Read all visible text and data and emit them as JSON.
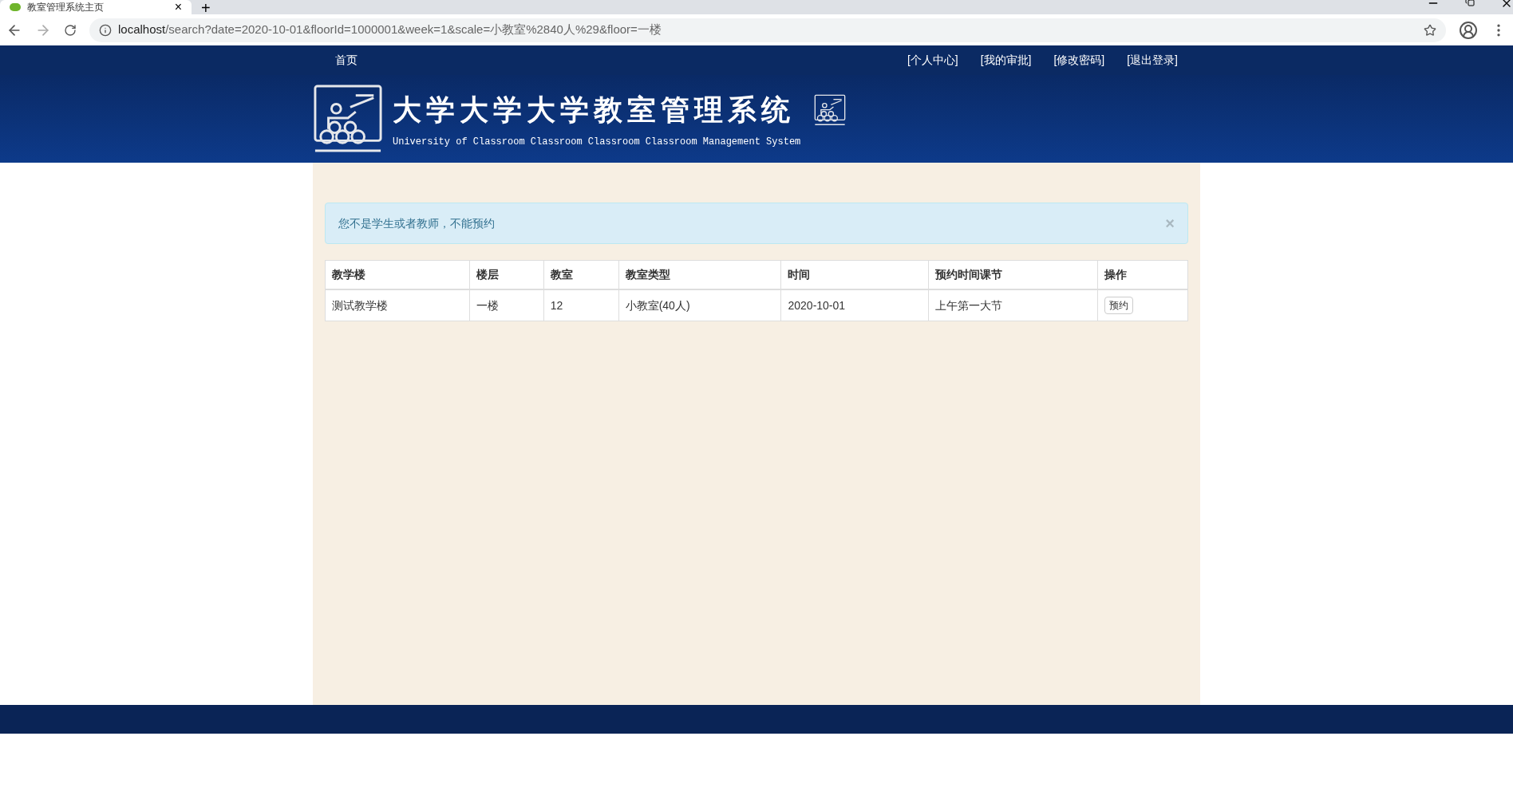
{
  "browser": {
    "tab_title": "教室管理系统主页",
    "new_tab": "+",
    "tab_close": "×",
    "url_host": "localhost",
    "url_path": "/search?date=2020-10-01&floorId=1000001&week=1&scale=小教室%2840人%29&floor=一楼"
  },
  "navbar": {
    "home": "首页",
    "links": [
      "[个人中心]",
      "[我的审批]",
      "[修改密码]",
      "[退出登录]"
    ]
  },
  "banner": {
    "title": "大学大学大学教室管理系统",
    "subtitle": "University of Classroom Classroom Classroom Classroom Management System"
  },
  "alert": {
    "text": "您不是学生或者教师，不能预约",
    "close": "×"
  },
  "table": {
    "columns": [
      "教学楼",
      "楼层",
      "教室",
      "教室类型",
      "时间",
      "预约时间课节",
      "操作"
    ],
    "rows": [
      {
        "cells": [
          "测试教学楼",
          "一楼",
          "12",
          "小教室(40人)",
          "2020-10-01",
          "上午第一大节"
        ],
        "action": "预约"
      }
    ]
  }
}
